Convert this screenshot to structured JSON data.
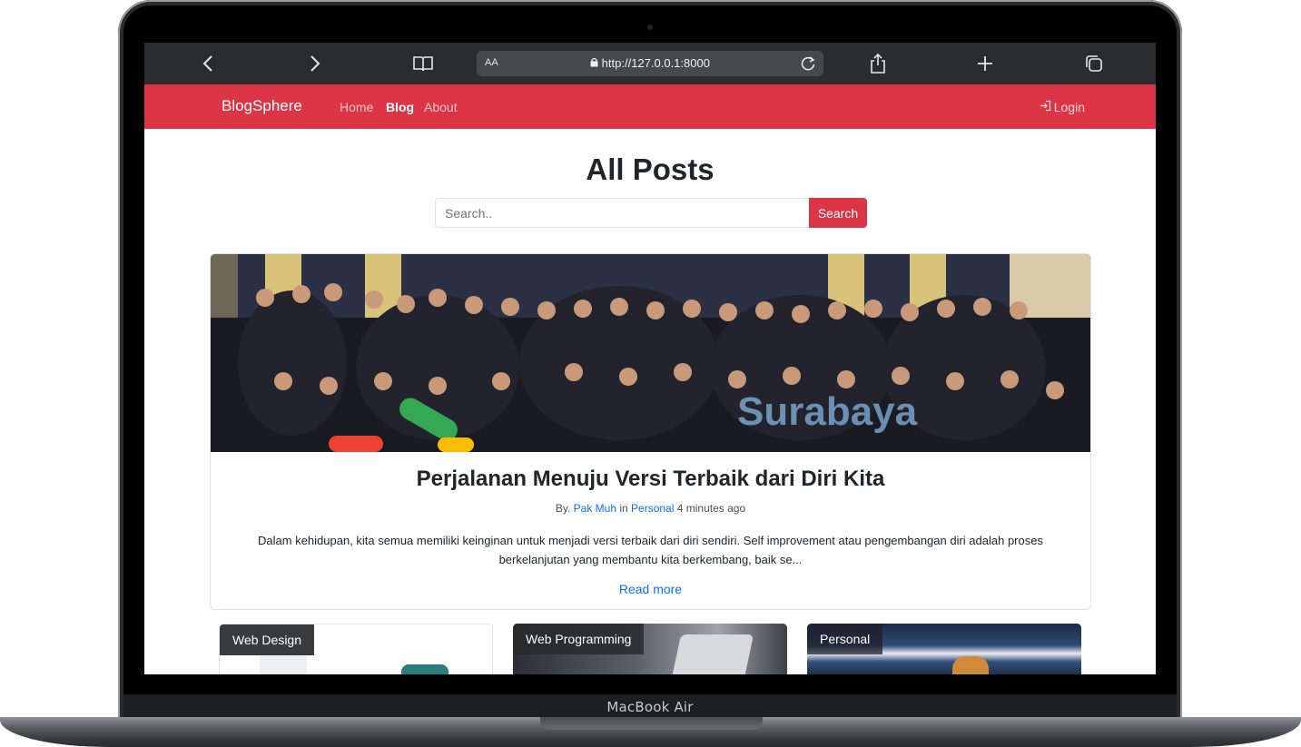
{
  "device": {
    "label": "MacBook Air"
  },
  "browser": {
    "text_size_label": "AA",
    "url": "http://127.0.0.1:8000",
    "icons": [
      "chevron-left-icon",
      "chevron-right-icon",
      "book-icon",
      "lock-icon",
      "reload-icon",
      "share-icon",
      "plus-icon",
      "tabs-icon"
    ]
  },
  "navbar": {
    "brand": "BlogSphere",
    "links": [
      {
        "label": "Home",
        "active": false
      },
      {
        "label": "Blog",
        "active": true
      },
      {
        "label": "About",
        "active": false
      }
    ],
    "login_label": "Login",
    "color": "#dc3545"
  },
  "main": {
    "title": "All Posts",
    "search": {
      "placeholder": "Search..",
      "value": "",
      "button_label": "Search"
    }
  },
  "featured_post": {
    "image_alt": "Group photo GDG Surabaya",
    "image_sign_text": "Surabaya",
    "title": "Perjalanan Menuju Versi Terbaik dari Diri Kita",
    "meta": {
      "by_label": "By.",
      "author": "Pak Muh",
      "in_label": "in",
      "category": "Personal",
      "time": "4 minutes ago"
    },
    "excerpt": "Dalam kehidupan, kita semua memiliki keinginan untuk menjadi versi terbaik dari diri sendiri. Self improvement atau pengembangan diri adalah proses berkelanjutan yang membantu kita berkembang, baik se...",
    "read_more_label": "Read more"
  },
  "post_cards": [
    {
      "category": "Web Design"
    },
    {
      "category": "Web Programming"
    },
    {
      "category": "Personal"
    }
  ]
}
